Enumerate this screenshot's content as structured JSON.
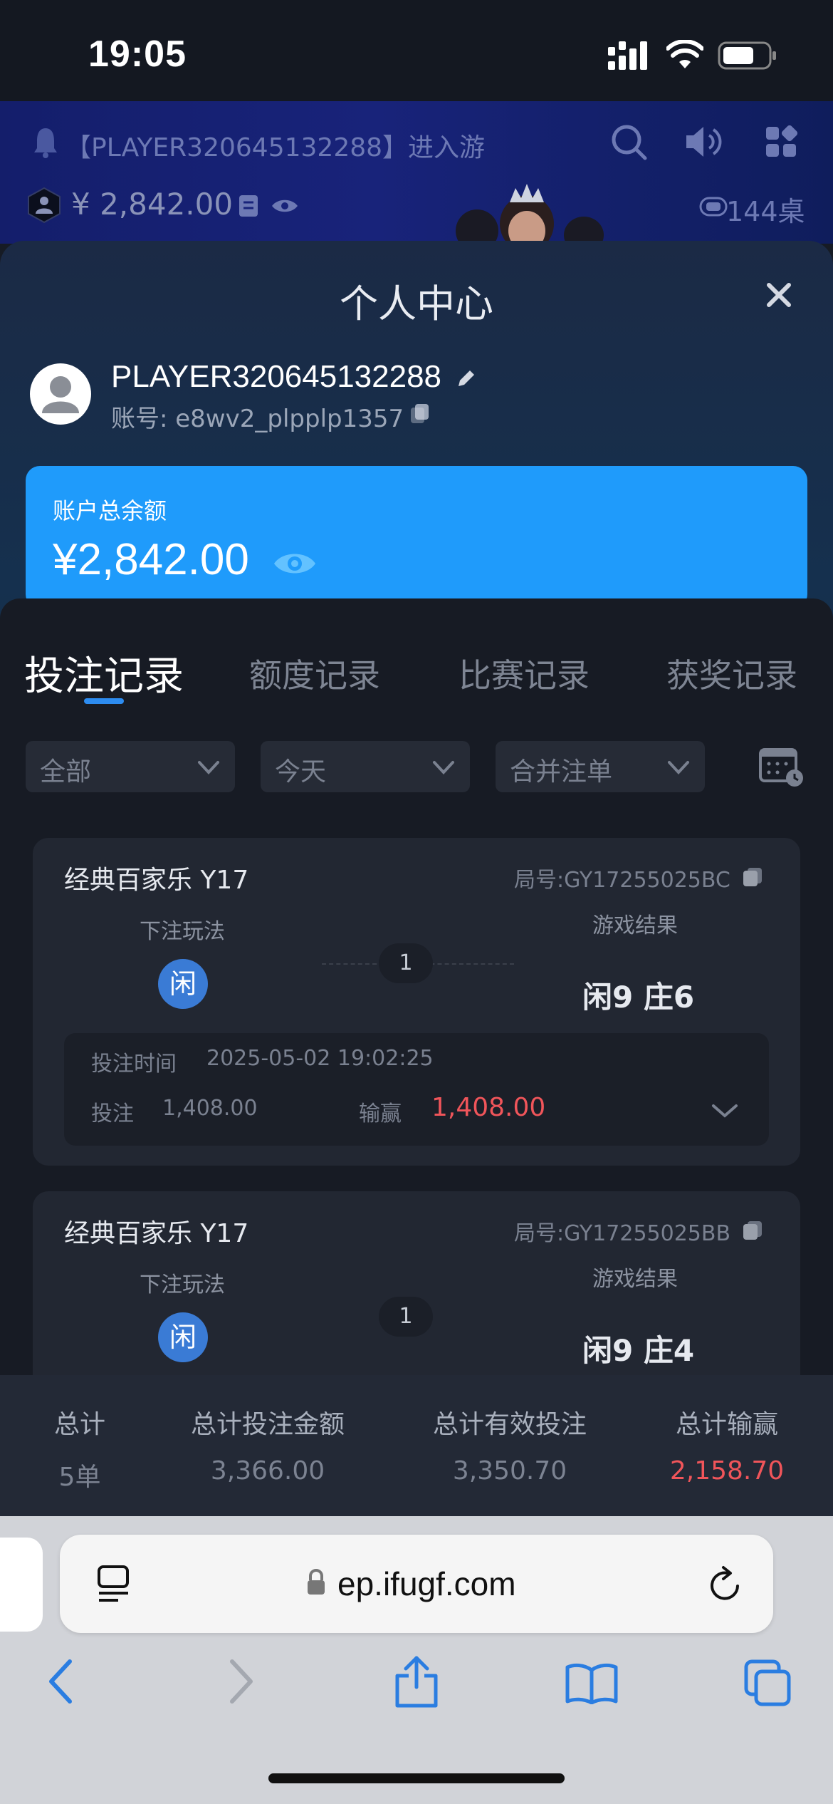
{
  "status_bar": {
    "time": "19:05"
  },
  "game_header": {
    "marquee": "【PLAYER320645132288】进入游",
    "balance": "¥ 2,842.00",
    "tables": "144桌"
  },
  "modal": {
    "title": "个人中心",
    "username": "PLAYER320645132288",
    "account": "账号: e8wv2_plpplp1357",
    "balance_label": "账户总余额",
    "balance_value": "¥2,842.00"
  },
  "tabs": [
    "投注记录",
    "额度记录",
    "比赛记录",
    "获奖记录"
  ],
  "filters": [
    "全部",
    "今天",
    "合并注单"
  ],
  "records": [
    {
      "game": "经典百家乐 Y17",
      "round_no": "局号:GY17255025BC",
      "bet_type_label": "下注玩法",
      "bet_type": "闲",
      "count": "1",
      "result_label": "游戏结果",
      "result": "闲9  庄6",
      "time_label": "投注时间",
      "time": "2025-05-02 19:02:25",
      "bet_label": "投注",
      "bet": "1,408.00",
      "winloss_label": "输赢",
      "winloss": "1,408.00"
    },
    {
      "game": "经典百家乐 Y17",
      "round_no": "局号:GY17255025BB",
      "bet_type_label": "下注玩法",
      "bet_type": "闲",
      "count": "1",
      "result_label": "游戏结果",
      "result": "闲9  庄4"
    }
  ],
  "summary": {
    "total_label": "总计",
    "total_value": "5单",
    "bet_label": "总计投注金额",
    "bet_value": "3,366.00",
    "valid_label": "总计有效投注",
    "valid_value": "3,350.70",
    "winloss_label": "总计输赢",
    "winloss_value": "2,158.70"
  },
  "browser": {
    "url": "ep.ifugf.com"
  },
  "colors": {
    "accent": "#1f9bfb",
    "loss": "#f0555a",
    "badge": "#3a7bd5"
  }
}
